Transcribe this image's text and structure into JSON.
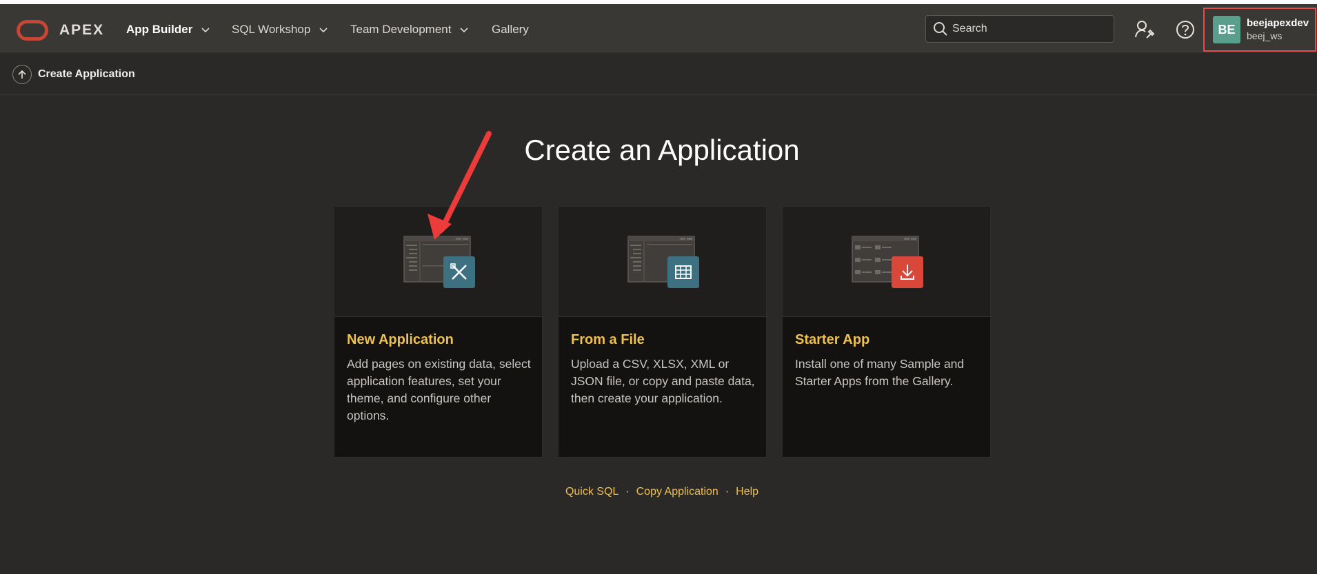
{
  "header": {
    "logo_text": "APEX",
    "nav": [
      {
        "label": "App Builder",
        "active": true
      },
      {
        "label": "SQL Workshop"
      },
      {
        "label": "Team Development"
      },
      {
        "label": "Gallery"
      }
    ],
    "search_placeholder": "Search",
    "user": {
      "initials": "BE",
      "name": "beejapexdev",
      "workspace": "beej_ws"
    }
  },
  "breadcrumb": {
    "title": "Create Application"
  },
  "page": {
    "title": "Create an Application",
    "cards": [
      {
        "title": "New Application",
        "description": "Add pages on existing data, select application features, set your theme, and configure other options.",
        "icon": "pencil-ruler-icon",
        "badge_color": "#3d7080"
      },
      {
        "title": "From a File",
        "description": "Upload a CSV, XLSX, XML or JSON file, or copy and paste data, then create your application.",
        "icon": "table-grid-icon",
        "badge_color": "#3d7080"
      },
      {
        "title": "Starter App",
        "description": "Install one of many Sample and Starter Apps from the Gallery.",
        "icon": "download-icon",
        "badge_color": "#d9473a"
      }
    ],
    "links": [
      "Quick SQL",
      "Copy Application",
      "Help"
    ]
  },
  "colors": {
    "accent": "#f0c04c",
    "brand": "#c74634",
    "highlight": "#e24c4c",
    "annotation_arrow": "#ec3b3b"
  }
}
